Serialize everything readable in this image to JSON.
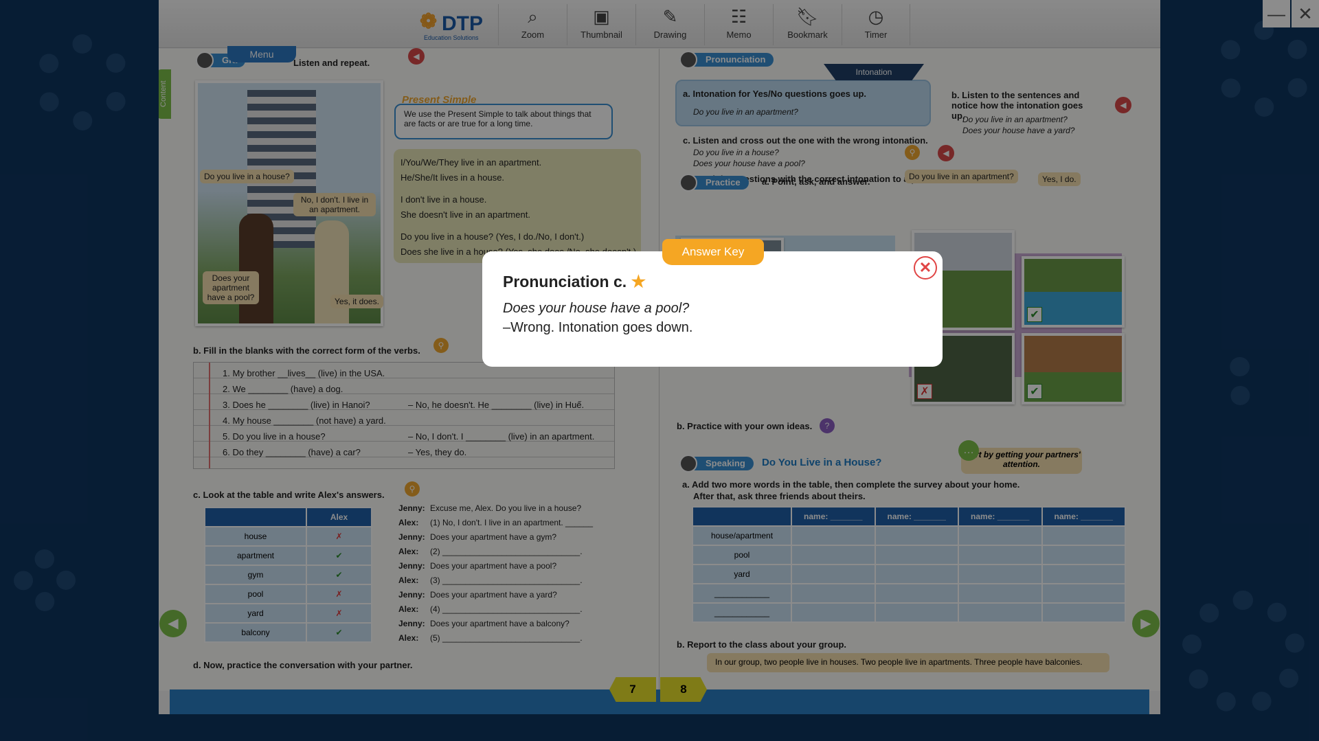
{
  "window": {
    "minimize_icon": "minimize-icon",
    "close_icon": "close-icon"
  },
  "logo": {
    "name": "DTP",
    "sub": "Education Solutions"
  },
  "toolbar": {
    "tools": [
      {
        "label": "Zoom",
        "icon": "zoom-icon",
        "glyph": "⌕"
      },
      {
        "label": "Thumbnail",
        "icon": "thumbnail-icon",
        "glyph": "▣"
      },
      {
        "label": "Drawing",
        "icon": "drawing-icon",
        "glyph": "✎"
      },
      {
        "label": "Memo",
        "icon": "memo-icon",
        "glyph": "☷"
      },
      {
        "label": "Bookmark",
        "icon": "bookmark-icon",
        "glyph": "⌕"
      },
      {
        "label": "Timer",
        "icon": "timer-icon",
        "glyph": "◷"
      }
    ]
  },
  "left": {
    "menu_tab": "Menu",
    "grammar_tag": "Gra",
    "content_tab": "Content",
    "listen_repeat": "Listen and repeat.",
    "bubbles": {
      "q1": "Do you live in a house?",
      "a1": "No, I don't. I live in an apartment.",
      "q2": "Does your apartment have a pool?",
      "a2": "Yes, it does."
    },
    "present_simple_title": "Present Simple",
    "present_simple_desc": "We use the Present Simple to talk about things that are facts or are true for a long time.",
    "grammar_lines": [
      "I/You/We/They live in an apartment.",
      "He/She/It lives in a house.",
      "I don't live in a house.",
      "She doesn't live in an apartment.",
      "Do you live in a house? (Yes, I do./No, I don't.)",
      "Does she live in a house? (Yes, she does./No, she doesn't.)"
    ],
    "fill_title": "b. Fill in the blanks with the correct form of the verbs.",
    "fill_lines": [
      "1. My brother __lives__ (live) in the USA.",
      "2. We ________ (have) a dog.",
      "3. Does he ________ (live) in Hanoi?",
      "4. My house ________ (not have) a yard.",
      "5. Do you live in a house?",
      "6. Do they ________ (have) a car?"
    ],
    "fill_answers": [
      "",
      "",
      "–   No, he doesn't. He ________ (live) in Huế.",
      "",
      "–   No, I don't. I ________ (live) in an apartment.",
      "–   Yes, they do."
    ],
    "table_title": "c. Look at the table and write Alex's answers.",
    "table_header": "Alex",
    "table_rows": [
      {
        "item": "house",
        "mark": "✗"
      },
      {
        "item": "apartment",
        "mark": "✔"
      },
      {
        "item": "gym",
        "mark": "✔"
      },
      {
        "item": "pool",
        "mark": "✗"
      },
      {
        "item": "yard",
        "mark": "✗"
      },
      {
        "item": "balcony",
        "mark": "✔"
      }
    ],
    "dialog": [
      {
        "speaker": "Jenny:",
        "line": "Excuse me, Alex. Do you live in a house?"
      },
      {
        "speaker": "Alex:",
        "line": "(1) No, I don't. I live in an apartment. ______"
      },
      {
        "speaker": "Jenny:",
        "line": "Does your apartment have a gym?"
      },
      {
        "speaker": "Alex:",
        "line": "(2) ______________________________."
      },
      {
        "speaker": "Jenny:",
        "line": "Does your apartment have a pool?"
      },
      {
        "speaker": "Alex:",
        "line": "(3) ______________________________."
      },
      {
        "speaker": "Jenny:",
        "line": "Does your apartment have a yard?"
      },
      {
        "speaker": "Alex:",
        "line": "(4) ______________________________."
      },
      {
        "speaker": "Jenny:",
        "line": "Does your apartment have a balcony?"
      },
      {
        "speaker": "Alex:",
        "line": "(5) ______________________________."
      }
    ],
    "practice_conv": "d. Now, practice the conversation with your partner.",
    "page_number": "7"
  },
  "right": {
    "pronunciation_tag": "Pronunciation",
    "intonation_tab": "Intonation",
    "pron_a": "a. Intonation for Yes/No questions goes up.",
    "pron_a_example": "Do you live in an apartment?",
    "pron_b": "b. Listen to the sentences and notice how the intonation goes up.",
    "pron_b_ex1": "Do you live in an apartment?",
    "pron_b_ex2": "Does your house have a yard?",
    "pron_c": "c. Listen and cross out the one with the wrong intonation.",
    "pron_c_ex1": "Do you live in a house?",
    "pron_c_ex2": "Does your house have a pool?",
    "pron_d": "d. Read the questions with the correct intonation to a partner.",
    "practice_tag": "Practice",
    "practice_a": "a. Point, ask, and answer.",
    "practice_q": "Do you live in an apartment?",
    "practice_ans": "Yes, I do.",
    "practice_b": "b. Practice with your own ideas.",
    "speaking_tag": "Speaking",
    "speaking_title": "Do You Live in a House?",
    "speaking_tip": "Start by getting your partners' attention.",
    "speaking_a": "a. Add two more words in the table, then complete the survey about your home.",
    "speaking_a2": "After that, ask three friends about theirs.",
    "survey_header": "name: _______",
    "survey_rows": [
      "house/apartment",
      "pool",
      "yard",
      "____________",
      "____________"
    ],
    "report": "b. Report to the class about your group.",
    "report_example": "In our group, two people live in houses. Two people live in apartments. Three people have balconies.",
    "page_number": "8"
  },
  "answer_key": {
    "tab": "Answer Key",
    "title": "Pronunciation c.",
    "question": "Does your house have a pool?",
    "answer": "–Wrong. Intonation goes down."
  }
}
